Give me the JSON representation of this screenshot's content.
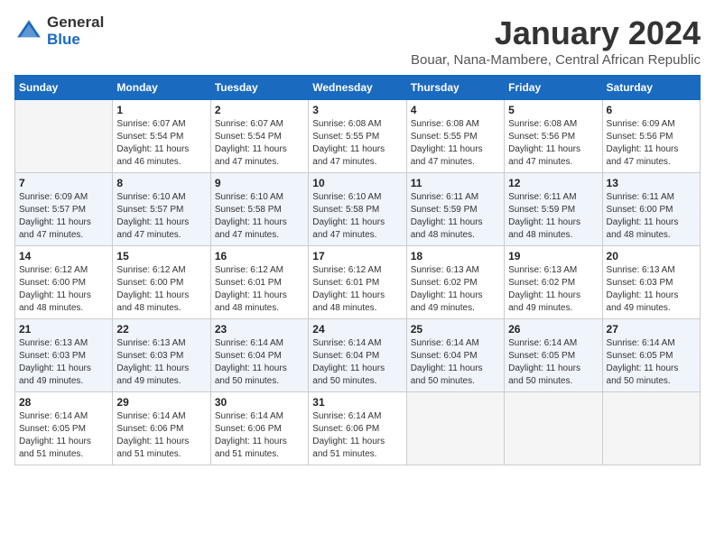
{
  "header": {
    "logo_general": "General",
    "logo_blue": "Blue",
    "month_title": "January 2024",
    "location": "Bouar, Nana-Mambere, Central African Republic"
  },
  "calendar": {
    "headers": [
      "Sunday",
      "Monday",
      "Tuesday",
      "Wednesday",
      "Thursday",
      "Friday",
      "Saturday"
    ],
    "weeks": [
      [
        {
          "day": "",
          "info": ""
        },
        {
          "day": "1",
          "info": "Sunrise: 6:07 AM\nSunset: 5:54 PM\nDaylight: 11 hours\nand 46 minutes."
        },
        {
          "day": "2",
          "info": "Sunrise: 6:07 AM\nSunset: 5:54 PM\nDaylight: 11 hours\nand 47 minutes."
        },
        {
          "day": "3",
          "info": "Sunrise: 6:08 AM\nSunset: 5:55 PM\nDaylight: 11 hours\nand 47 minutes."
        },
        {
          "day": "4",
          "info": "Sunrise: 6:08 AM\nSunset: 5:55 PM\nDaylight: 11 hours\nand 47 minutes."
        },
        {
          "day": "5",
          "info": "Sunrise: 6:08 AM\nSunset: 5:56 PM\nDaylight: 11 hours\nand 47 minutes."
        },
        {
          "day": "6",
          "info": "Sunrise: 6:09 AM\nSunset: 5:56 PM\nDaylight: 11 hours\nand 47 minutes."
        }
      ],
      [
        {
          "day": "7",
          "info": "Sunrise: 6:09 AM\nSunset: 5:57 PM\nDaylight: 11 hours\nand 47 minutes."
        },
        {
          "day": "8",
          "info": "Sunrise: 6:10 AM\nSunset: 5:57 PM\nDaylight: 11 hours\nand 47 minutes."
        },
        {
          "day": "9",
          "info": "Sunrise: 6:10 AM\nSunset: 5:58 PM\nDaylight: 11 hours\nand 47 minutes."
        },
        {
          "day": "10",
          "info": "Sunrise: 6:10 AM\nSunset: 5:58 PM\nDaylight: 11 hours\nand 47 minutes."
        },
        {
          "day": "11",
          "info": "Sunrise: 6:11 AM\nSunset: 5:59 PM\nDaylight: 11 hours\nand 48 minutes."
        },
        {
          "day": "12",
          "info": "Sunrise: 6:11 AM\nSunset: 5:59 PM\nDaylight: 11 hours\nand 48 minutes."
        },
        {
          "day": "13",
          "info": "Sunrise: 6:11 AM\nSunset: 6:00 PM\nDaylight: 11 hours\nand 48 minutes."
        }
      ],
      [
        {
          "day": "14",
          "info": "Sunrise: 6:12 AM\nSunset: 6:00 PM\nDaylight: 11 hours\nand 48 minutes."
        },
        {
          "day": "15",
          "info": "Sunrise: 6:12 AM\nSunset: 6:00 PM\nDaylight: 11 hours\nand 48 minutes."
        },
        {
          "day": "16",
          "info": "Sunrise: 6:12 AM\nSunset: 6:01 PM\nDaylight: 11 hours\nand 48 minutes."
        },
        {
          "day": "17",
          "info": "Sunrise: 6:12 AM\nSunset: 6:01 PM\nDaylight: 11 hours\nand 48 minutes."
        },
        {
          "day": "18",
          "info": "Sunrise: 6:13 AM\nSunset: 6:02 PM\nDaylight: 11 hours\nand 49 minutes."
        },
        {
          "day": "19",
          "info": "Sunrise: 6:13 AM\nSunset: 6:02 PM\nDaylight: 11 hours\nand 49 minutes."
        },
        {
          "day": "20",
          "info": "Sunrise: 6:13 AM\nSunset: 6:03 PM\nDaylight: 11 hours\nand 49 minutes."
        }
      ],
      [
        {
          "day": "21",
          "info": "Sunrise: 6:13 AM\nSunset: 6:03 PM\nDaylight: 11 hours\nand 49 minutes."
        },
        {
          "day": "22",
          "info": "Sunrise: 6:13 AM\nSunset: 6:03 PM\nDaylight: 11 hours\nand 49 minutes."
        },
        {
          "day": "23",
          "info": "Sunrise: 6:14 AM\nSunset: 6:04 PM\nDaylight: 11 hours\nand 50 minutes."
        },
        {
          "day": "24",
          "info": "Sunrise: 6:14 AM\nSunset: 6:04 PM\nDaylight: 11 hours\nand 50 minutes."
        },
        {
          "day": "25",
          "info": "Sunrise: 6:14 AM\nSunset: 6:04 PM\nDaylight: 11 hours\nand 50 minutes."
        },
        {
          "day": "26",
          "info": "Sunrise: 6:14 AM\nSunset: 6:05 PM\nDaylight: 11 hours\nand 50 minutes."
        },
        {
          "day": "27",
          "info": "Sunrise: 6:14 AM\nSunset: 6:05 PM\nDaylight: 11 hours\nand 50 minutes."
        }
      ],
      [
        {
          "day": "28",
          "info": "Sunrise: 6:14 AM\nSunset: 6:05 PM\nDaylight: 11 hours\nand 51 minutes."
        },
        {
          "day": "29",
          "info": "Sunrise: 6:14 AM\nSunset: 6:06 PM\nDaylight: 11 hours\nand 51 minutes."
        },
        {
          "day": "30",
          "info": "Sunrise: 6:14 AM\nSunset: 6:06 PM\nDaylight: 11 hours\nand 51 minutes."
        },
        {
          "day": "31",
          "info": "Sunrise: 6:14 AM\nSunset: 6:06 PM\nDaylight: 11 hours\nand 51 minutes."
        },
        {
          "day": "",
          "info": ""
        },
        {
          "day": "",
          "info": ""
        },
        {
          "day": "",
          "info": ""
        }
      ]
    ]
  }
}
